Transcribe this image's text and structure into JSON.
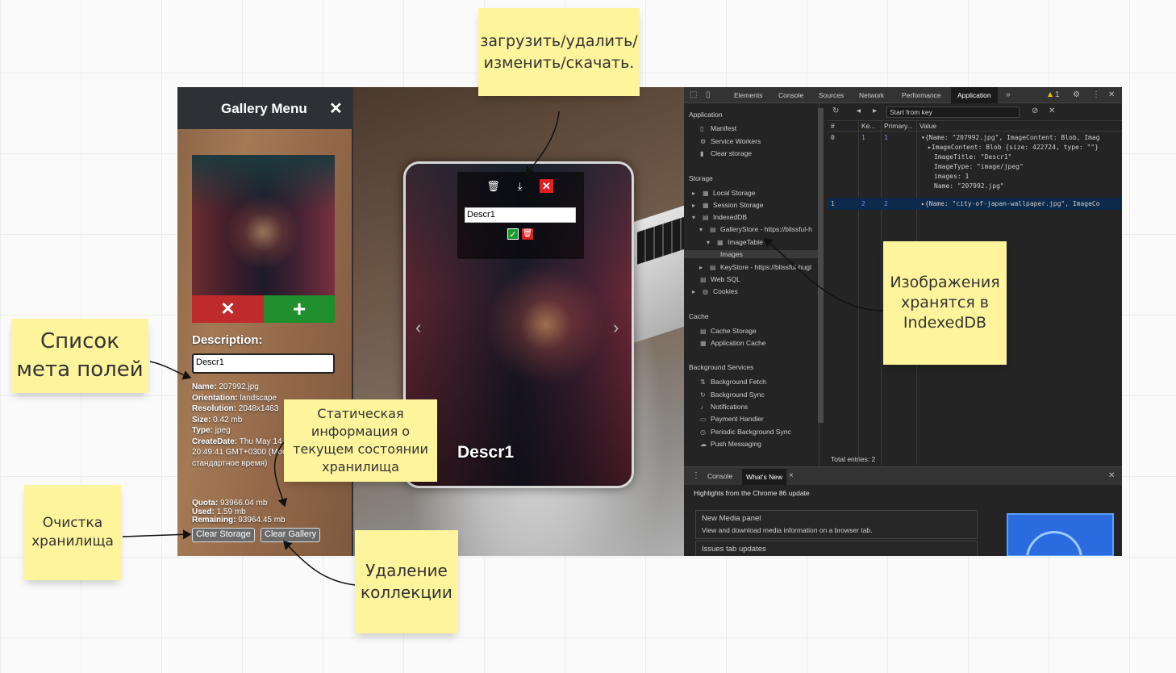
{
  "gallery": {
    "title": "Gallery Menu",
    "close_symbol": "✕",
    "delete_image_symbol": "✕",
    "add_image_symbol": "+",
    "description_label": "Description:",
    "description_value": "Descr1",
    "meta": {
      "name_label": "Name:",
      "name_value": "207992.jpg",
      "orientation_label": "Orientation:",
      "orientation_value": "landscape",
      "resolution_label": "Resolution:",
      "resolution_value": "2048x1463",
      "size_label": "Size:",
      "size_value": "0.42 mb",
      "type_label": "Type:",
      "type_value": "jpeg",
      "createdate_label": "CreateDate:",
      "createdate_value": "Thu May 14",
      "createdate_line2": "20:49:41 GMT+0300 (Моск",
      "createdate_line3": "стандартное время)"
    },
    "quota_label": "Quota:",
    "quota_value": "93966.04 mb",
    "used_label": "Used:",
    "used_value": "1.59 mb",
    "remaining_label": "Remaining:",
    "remaining_value": "93964.45 mb",
    "clear_storage_label": "Clear Storage",
    "clear_gallery_label": "Clear Gallery"
  },
  "viewer": {
    "caption": "Descr1",
    "prev_arrow": "‹",
    "next_arrow": "›",
    "edit_input_value": "Descr1",
    "trash_symbol": "🗑",
    "download_symbol": "⤓",
    "close_symbol": "✕",
    "confirm_symbol": "✓"
  },
  "devtools": {
    "tabs": [
      "Elements",
      "Console",
      "Sources",
      "Network",
      "Performance",
      "Application"
    ],
    "more_tabs": "»",
    "warning_count": "1",
    "sections": {
      "application": "Application",
      "storage": "Storage",
      "cache": "Cache",
      "background": "Background Services"
    },
    "app_items": [
      "Manifest",
      "Service Workers",
      "Clear storage"
    ],
    "storage_items": [
      "Local Storage",
      "Session Storage",
      "IndexedDB",
      "GalleryStore - https://blissful-h",
      "ImageTable",
      "Images",
      "KeyStore - https://blissful-hugl",
      "Web SQL",
      "Cookies"
    ],
    "cache_items": [
      "Cache Storage",
      "Application Cache"
    ],
    "background_items": [
      "Background Fetch",
      "Background Sync",
      "Notifications",
      "Payment Handler",
      "Periodic Background Sync",
      "Push Messaging"
    ],
    "filter_placeholder": "Start from key",
    "columns": [
      "#",
      "Ke...",
      "Primary...",
      "Value"
    ],
    "row1": {
      "index": "0",
      "key": "1",
      "primary": "1",
      "line1": "▾{Name: \"207992.jpg\", ImageContent: Blob, Imag",
      "line2": "▸ImageContent: Blob {size: 422724, type: \"\"}",
      "line3": "ImageTitle: \"Descr1\"",
      "line4": "ImageType: \"image/jpeg\"",
      "line5": "images: 1",
      "line6": "Name: \"207992.jpg\""
    },
    "row2": {
      "index": "1",
      "key": "2",
      "primary": "2",
      "line1": "▸{Name: \"city-of-japan-wallpaper.jpg\", ImageCo"
    },
    "total_entries": "Total entries: 2",
    "drawer": {
      "tabs": [
        "Console",
        "What's New"
      ],
      "headline": "Highlights from the Chrome 86 update",
      "card1_title": "New Media panel",
      "card1_text": "View and download media information on a browser tab.",
      "card2_title": "Issues tab updates"
    }
  },
  "notes": {
    "actions": "загрузить/удалить/\nизменить/скачать.",
    "meta_list": "Список\nмета полей",
    "static_info": "Статическая\nинформация  о\nтекущем состоянии\nхранилища",
    "indexeddb": "Изображения\nхранятся в\nIndexedDB",
    "clear_storage": "Очистка\nхранилища",
    "delete_collection": "Удаление\nколлекции"
  }
}
